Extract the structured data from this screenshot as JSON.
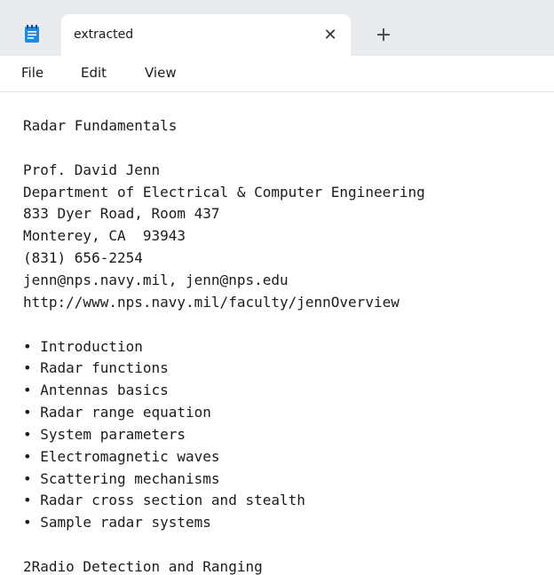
{
  "window": {
    "tab_title": "extracted",
    "close_glyph": "✕",
    "new_tab_glyph": "+",
    "app_icon": "notepad-icon"
  },
  "menu": {
    "items": [
      "File",
      "Edit",
      "View"
    ]
  },
  "document": {
    "lines": [
      "Radar Fundamentals",
      "",
      "Prof. David Jenn",
      "Department of Electrical & Computer Engineering",
      "833 Dyer Road, Room 437",
      "Monterey, CA  93943",
      "(831) 656-2254",
      "jenn@nps.navy.mil, jenn@nps.edu",
      "http://www.nps.navy.mil/faculty/jennOverview",
      "",
      "• Introduction",
      "• Radar functions",
      "• Antennas basics",
      "• Radar range equation",
      "• System parameters",
      "• Electromagnetic waves",
      "• Scattering mechanisms",
      "• Radar cross section and stealth",
      "• Sample radar systems",
      "",
      "2Radio Detection and Ranging"
    ]
  },
  "colors": {
    "tabbar_bg": "#e9ecef",
    "accent": "#1a73e8"
  }
}
